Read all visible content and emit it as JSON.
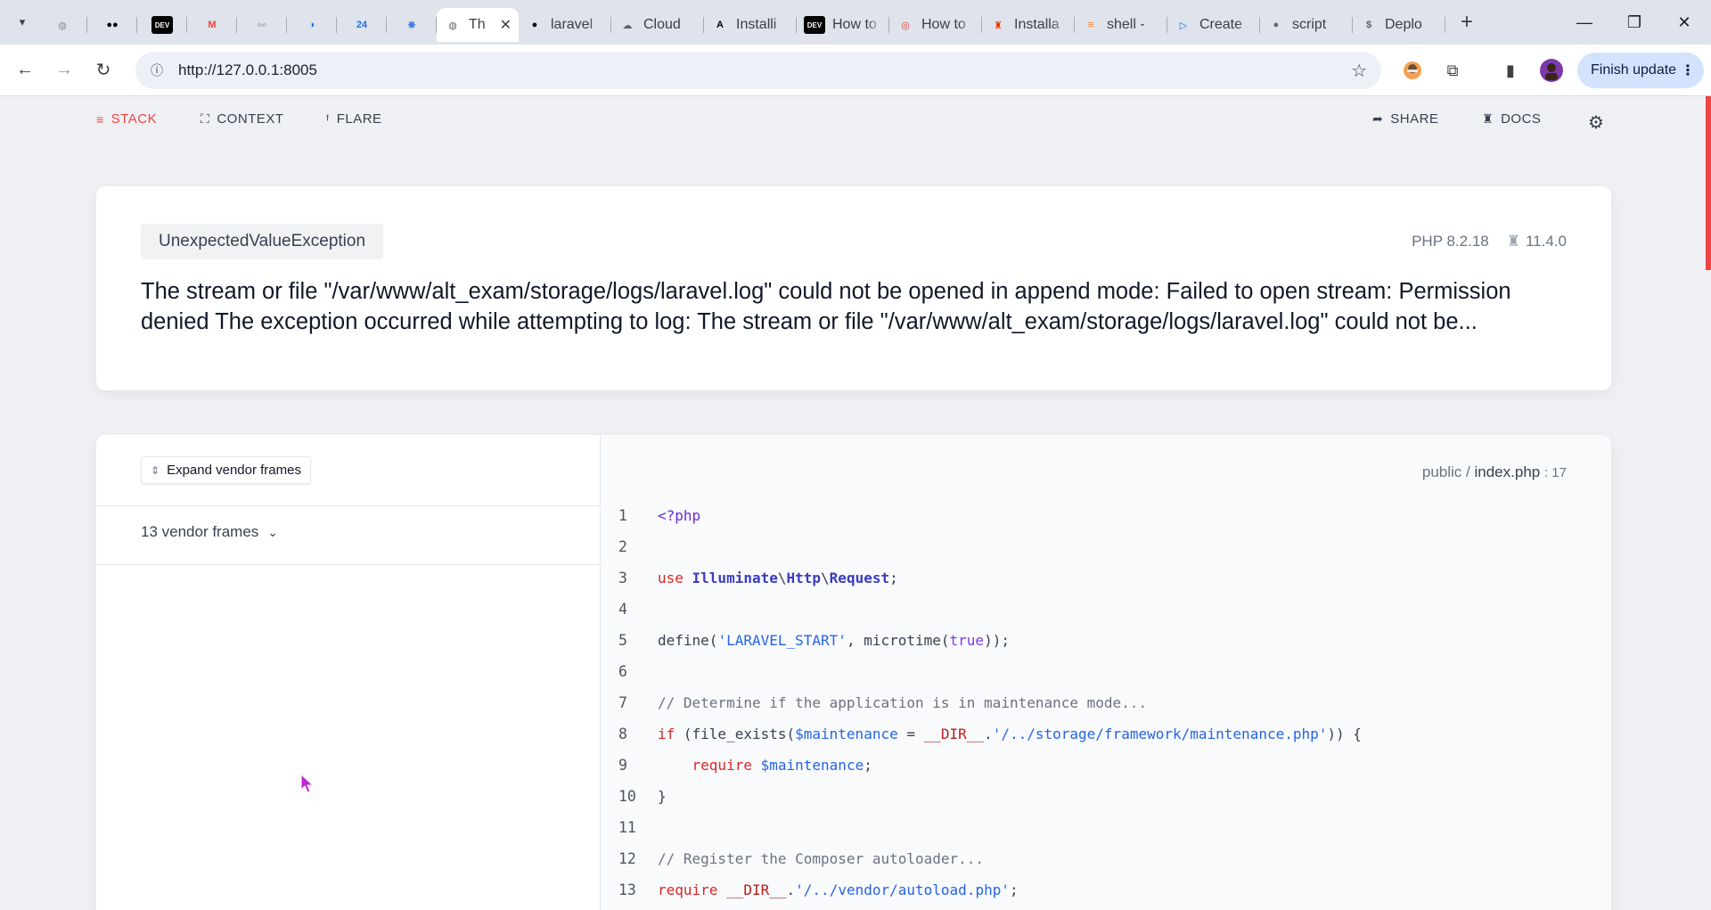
{
  "browser": {
    "tabs": [
      {
        "icon": "world-icon",
        "title": "",
        "color": "#8a8f98",
        "glyph": "◍"
      },
      {
        "icon": "medium-icon",
        "title": "",
        "color": "#000000",
        "glyph": "●●"
      },
      {
        "icon": "dev-icon",
        "title": "",
        "color": "#000000",
        "glyph": "DEV"
      },
      {
        "icon": "gmail-icon",
        "title": "",
        "color": "#ea4335",
        "glyph": "M"
      },
      {
        "icon": "handshake-icon",
        "title": "",
        "color": "#9aa0a6",
        "glyph": "⚯"
      },
      {
        "icon": "globe-blue-icon",
        "title": "",
        "color": "#1a73e8",
        "glyph": "◑"
      },
      {
        "icon": "24-icon",
        "title": "",
        "color": "#1a73e8",
        "glyph": "24"
      },
      {
        "icon": "kubernetes-icon",
        "title": "",
        "color": "#326ce5",
        "glyph": "⎈"
      },
      {
        "icon": "world-icon",
        "title": "Th",
        "color": "#5f6368",
        "glyph": "◍",
        "active": true
      },
      {
        "icon": "github-icon",
        "title": "laravel",
        "color": "#000000",
        "glyph": "●"
      },
      {
        "icon": "cloud-icon",
        "title": "Cloud",
        "color": "#5f6368",
        "glyph": "☁"
      },
      {
        "icon": "angular-icon",
        "title": "Installi",
        "color": "#000000",
        "glyph": "A"
      },
      {
        "icon": "dev-icon",
        "title": "How to",
        "color": "#000000",
        "glyph": "DEV"
      },
      {
        "icon": "target-icon",
        "title": "How to",
        "color": "#e53935",
        "glyph": "◎"
      },
      {
        "icon": "laravel-icon",
        "title": "Installa",
        "color": "#f53003",
        "glyph": "♜"
      },
      {
        "icon": "stackoverflow-icon",
        "title": "shell -",
        "color": "#f48024",
        "glyph": "≡"
      },
      {
        "icon": "play-icon",
        "title": "Create",
        "color": "#1a73e8",
        "glyph": "▷"
      },
      {
        "icon": "github-icon",
        "title": "script",
        "color": "#5f6368",
        "glyph": "●"
      },
      {
        "icon": "dollar-icon",
        "title": "Deplo",
        "color": "#5f6368",
        "glyph": "$"
      }
    ],
    "url": "http://127.0.0.1:8005",
    "finish_update": "Finish update"
  },
  "ignition": {
    "nav": {
      "stack": "STACK",
      "context": "CONTEXT",
      "flare": "FLARE",
      "share": "SHARE",
      "docs": "DOCS"
    },
    "exception": {
      "class": "UnexpectedValueException",
      "php_version": "PHP 8.2.18",
      "laravel_version": "11.4.0",
      "message": "The stream or file \"/var/www/alt_exam/storage/logs/laravel.log\" could not be opened in append mode: Failed to open stream: Permission denied The exception occurred while attempting to log: The stream or file \"/var/www/alt_exam/storage/logs/laravel.log\" could not be..."
    },
    "stack": {
      "expand_label": "Expand vendor frames",
      "vendor_frames_label": "13 vendor frames",
      "file_dir": "public /",
      "file_name": "index.php",
      "file_line": ": 17"
    },
    "code_lines": [
      {
        "n": "1",
        "tokens": [
          [
            "tag",
            "<?php"
          ]
        ]
      },
      {
        "n": "2",
        "tokens": []
      },
      {
        "n": "3",
        "tokens": [
          [
            "kw",
            "use "
          ],
          [
            "cls",
            "Illuminate"
          ],
          [
            "plain",
            "\\"
          ],
          [
            "cls",
            "Http"
          ],
          [
            "plain",
            "\\"
          ],
          [
            "cls",
            "Request"
          ],
          [
            "plain",
            ";"
          ]
        ]
      },
      {
        "n": "4",
        "tokens": []
      },
      {
        "n": "5",
        "tokens": [
          [
            "plain",
            "define("
          ],
          [
            "str",
            "'LARAVEL_START'"
          ],
          [
            "plain",
            ", microtime("
          ],
          [
            "bool",
            "true"
          ],
          [
            "plain",
            "));"
          ]
        ]
      },
      {
        "n": "6",
        "tokens": []
      },
      {
        "n": "7",
        "tokens": [
          [
            "cmt",
            "// Determine if the application is in maintenance mode..."
          ]
        ]
      },
      {
        "n": "8",
        "tokens": [
          [
            "kw",
            "if"
          ],
          [
            "plain",
            " (file_exists("
          ],
          [
            "var",
            "$maintenance"
          ],
          [
            "plain",
            " = "
          ],
          [
            "const",
            "__DIR__"
          ],
          [
            "plain",
            "."
          ],
          [
            "str",
            "'/../storage/framework/maintenance.php'"
          ],
          [
            "plain",
            ")) {"
          ]
        ]
      },
      {
        "n": "9",
        "tokens": [
          [
            "plain",
            "    "
          ],
          [
            "kw",
            "require"
          ],
          [
            "plain",
            " "
          ],
          [
            "var",
            "$maintenance"
          ],
          [
            "plain",
            ";"
          ]
        ]
      },
      {
        "n": "10",
        "tokens": [
          [
            "plain",
            "}"
          ]
        ]
      },
      {
        "n": "11",
        "tokens": []
      },
      {
        "n": "12",
        "tokens": [
          [
            "cmt",
            "// Register the Composer autoloader..."
          ]
        ]
      },
      {
        "n": "13",
        "tokens": [
          [
            "kw",
            "require"
          ],
          [
            "plain",
            " "
          ],
          [
            "const",
            "__DIR__"
          ],
          [
            "plain",
            "."
          ],
          [
            "str",
            "'/../vendor/autoload.php'"
          ],
          [
            "plain",
            ";"
          ]
        ]
      }
    ]
  },
  "colors": {
    "accent_red": "#ef4444",
    "page_bg": "#eef0f3",
    "tabstrip_bg": "#dfe3eb"
  }
}
